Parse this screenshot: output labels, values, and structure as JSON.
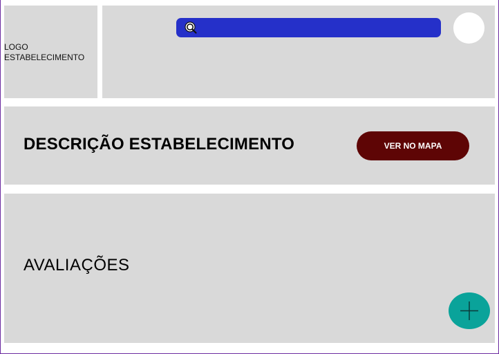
{
  "logo": {
    "text": "LOGO\nESTABELECIMENTO"
  },
  "header": {
    "search": {
      "value": "",
      "placeholder": "",
      "icon": "search-icon"
    },
    "avatar_icon": "avatar"
  },
  "description": {
    "title": "DESCRIÇÃO ESTABELECIMENTO",
    "map_button_label": "VER NO MAPA"
  },
  "reviews": {
    "title": "AVALIAÇÕES",
    "add_icon": "plus-icon"
  },
  "colors": {
    "panel": "#d9d9d9",
    "search_bar": "#2530c9",
    "map_button": "#5e0505",
    "add_button": "#0aa39a",
    "frame": "#6b2aa0"
  }
}
